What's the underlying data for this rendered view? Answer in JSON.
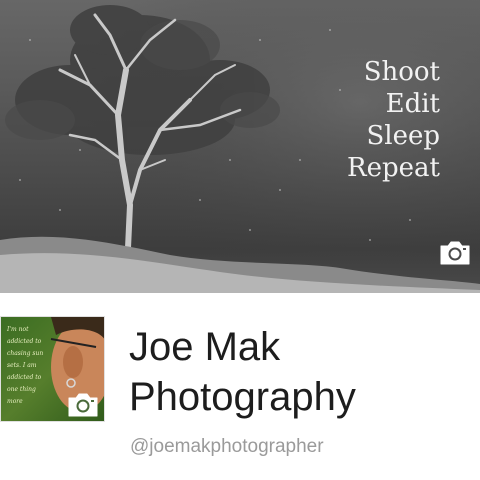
{
  "cover": {
    "tagline": [
      "Shoot",
      "Edit",
      "Sleep",
      "Repeat"
    ],
    "camera_icon": "camera-icon"
  },
  "profile": {
    "picture_camera_icon": "camera-icon",
    "picture_text": "I'm not addicted to chasing sunsets. I am addicted to one thing more",
    "name_line1": "Joe Mak",
    "name_line2": "Photography",
    "handle": "@joemakphotographer"
  },
  "colors": {
    "name_text": "#1d1d1d",
    "handle_text": "#9a9a9a",
    "tagline_text": "#f2f2f2"
  }
}
